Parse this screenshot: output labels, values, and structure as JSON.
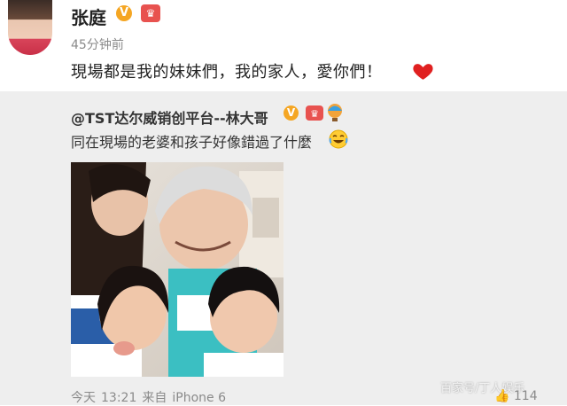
{
  "post": {
    "author": "张庭",
    "verified_badge": "V",
    "time": "45分钟前",
    "text": "現場都是我的妹妹們，我的家人，愛你們！",
    "icons": [
      "avatar",
      "vip-crown-icon",
      "heart-emoji-icon"
    ]
  },
  "repost": {
    "author": "@TST达尔威销创平台--林大哥",
    "verified_badge": "V",
    "text": "同在現場的老婆和孩子好像錯過了什麼",
    "icons": [
      "vip-crown-icon",
      "hot-air-balloon-icon",
      "laugh-tears-emoji-icon"
    ],
    "photo_alt": "family-selfie-photo",
    "meta": {
      "date": "今天",
      "time": "13:21",
      "source_prefix": "来自",
      "device": "iPhone 6"
    },
    "like_count": "114"
  },
  "watermark": "百家号/丁人娱乐",
  "colors": {
    "page_bg": "#ffffff",
    "repost_bg": "#eeeeee",
    "badge_orange": "#f5a623",
    "heart_red": "#e02020",
    "meta_gray": "#8a8a8a"
  }
}
